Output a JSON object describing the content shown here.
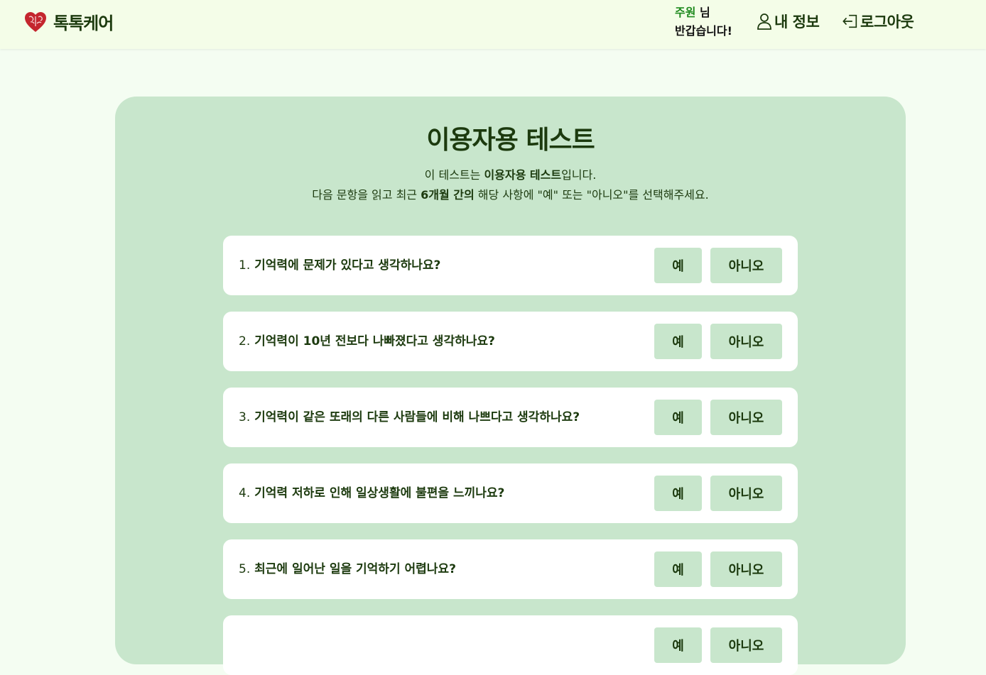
{
  "header": {
    "logo_text": "톡톡케어",
    "user_name": "주원",
    "user_suffix": " 님",
    "greeting": "반갑습니다!",
    "profile_label": "내 정보",
    "logout_label": "로그아웃"
  },
  "test": {
    "title": "이용자용 테스트",
    "desc1_a": "이 테스트는 ",
    "desc1_b": "이용자용 테스트",
    "desc1_c": "입니다.",
    "desc2_a": "다음 문항을 읽고 최근 ",
    "desc2_b": "6개월 간의",
    "desc2_c": " 해당 사항에 \"예\" 또는 \"아니오\"를 선택해주세요.",
    "yes_label": "예",
    "no_label": "아니오",
    "questions": [
      {
        "num": "1.",
        "text": "기억력에 문제가 있다고 생각하나요?"
      },
      {
        "num": "2.",
        "text": "기억력이 10년 전보다 나빠졌다고 생각하나요?"
      },
      {
        "num": "3.",
        "text": "기억력이 같은 또래의 다른 사람들에 비해 나쁘다고 생각하나요?"
      },
      {
        "num": "4.",
        "text": "기억력 저하로 인해 일상생활에 불편을 느끼나요?"
      },
      {
        "num": "5.",
        "text": "최근에 일어난 일을 기억하기 어렵나요?"
      },
      {
        "num": "",
        "text": ""
      }
    ]
  }
}
